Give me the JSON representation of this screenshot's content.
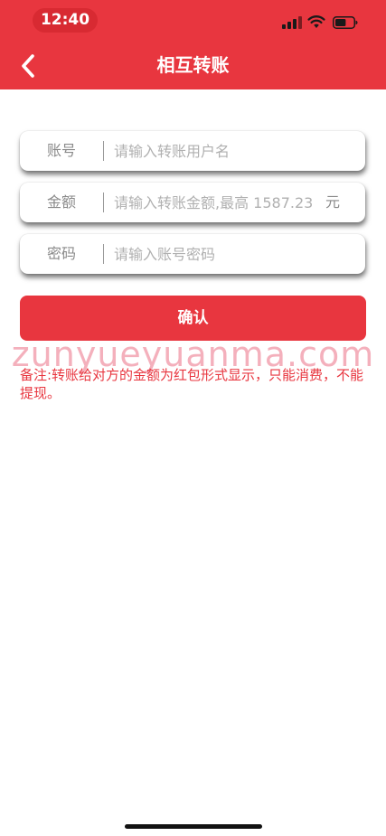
{
  "status_bar": {
    "time": "12:40",
    "icons": [
      "signal-icon",
      "wifi-icon",
      "battery-icon"
    ],
    "battery_level_percent": 60
  },
  "nav": {
    "back_icon": "chevron-left-icon",
    "title": "相互转账"
  },
  "form": {
    "account": {
      "label": "账号",
      "placeholder": "请输入转账用户名",
      "value": ""
    },
    "amount": {
      "label": "金额",
      "placeholder": "请输入转账金额,最高 1587.23",
      "unit": "元",
      "value": ""
    },
    "password": {
      "label": "密码",
      "placeholder": "请输入账号密码",
      "value": ""
    },
    "confirm_label": "确认"
  },
  "watermark": "zunyueyuanma.com",
  "note": "备注:转账给对方的金额为红包形式显示，只能消费，不能提现。",
  "colors": {
    "brand_red": "#e8363f",
    "placeholder_gray": "#b0b0b0",
    "label_gray": "#8a8a8a"
  }
}
